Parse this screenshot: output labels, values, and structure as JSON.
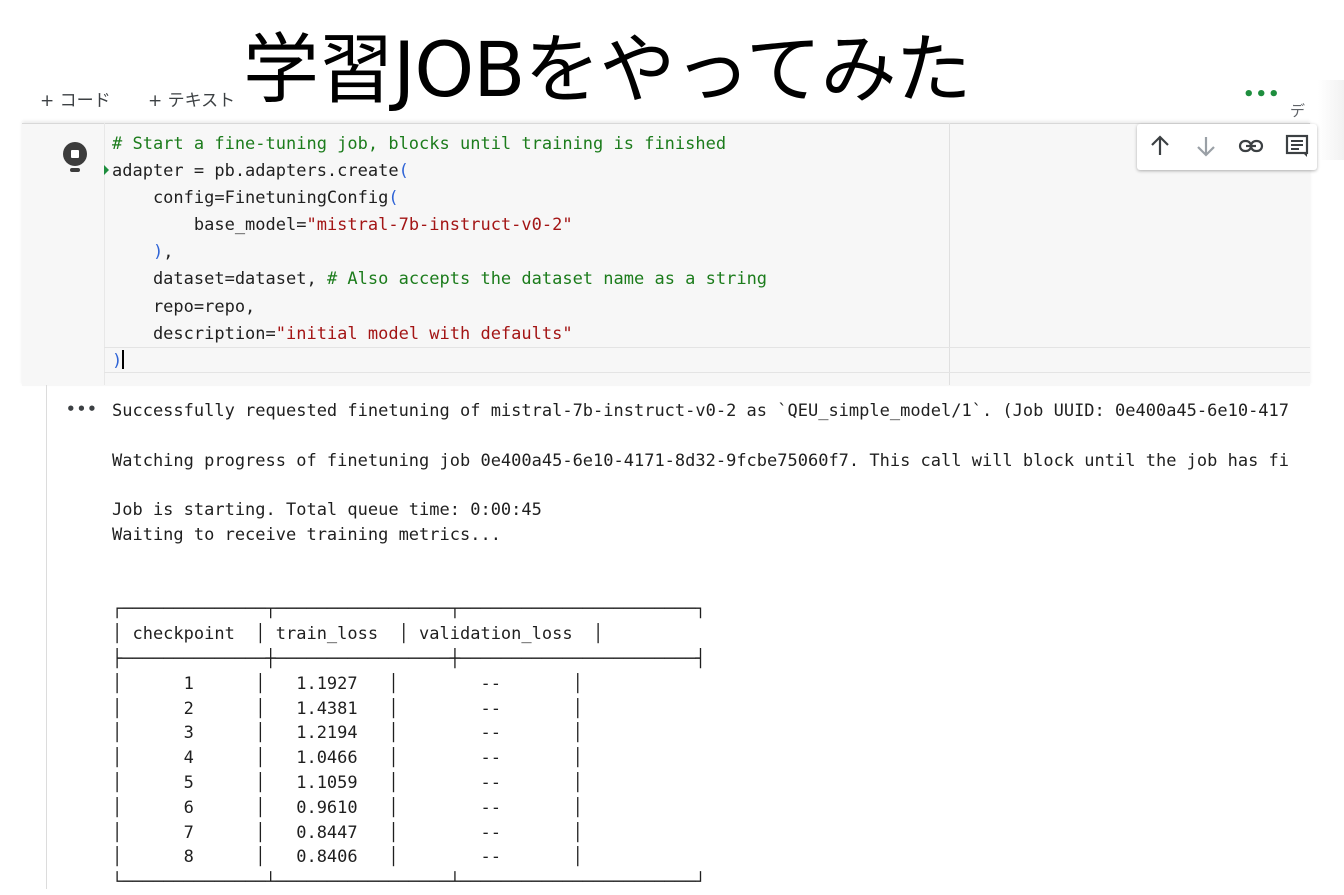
{
  "slide_title": "学習JOBをやってみた",
  "toolbar": {
    "add_code": "+ コード",
    "add_text": "+ テキスト",
    "more": "•••",
    "clipped_label": "デ"
  },
  "cell": {
    "code_lines": [
      "# Start a fine-tuning job, blocks until training is finished",
      "adapter = pb.adapters.create(",
      "    config=FinetuningConfig(",
      "        base_model=\"mistral-7b-instruct-v0-2\"",
      "    ),",
      "    dataset=dataset, # Also accepts the dataset name as a string",
      "    repo=repo,",
      "    description=\"initial model with defaults\"",
      ")"
    ],
    "toolbar_icons": [
      "arrow-up-icon",
      "arrow-down-icon",
      "link-icon",
      "comment-icon"
    ]
  },
  "output": {
    "more": "•••",
    "lines": [
      "Successfully requested finetuning of mistral-7b-instruct-v0-2 as `QEU_simple_model/1`. (Job UUID: 0e400a45-6e10-417",
      "",
      "Watching progress of finetuning job 0e400a45-6e10-4171-8d32-9fcbe75060f7. This call will block until the job has fi",
      "",
      "Job is starting. Total queue time: 0:00:45",
      "Waiting to receive training metrics...",
      "",
      "",
      "┌──────────────┬─────────────────┬───────────────────────┐",
      "│ checkpoint  │ train_loss  │ validation_loss  │",
      "├──────────────┼─────────────────┼───────────────────────┤",
      "│      1      │   1.1927   │        --       │",
      "│      2      │   1.4381   │        --       │",
      "│      3      │   1.2194   │        --       │",
      "│      4      │   1.0466   │        --       │",
      "│      5      │   1.1059   │        --       │",
      "│      6      │   0.9610   │        --       │",
      "│      7      │   0.8447   │        --       │",
      "│      8      │   0.8406   │        --       │",
      "└──────────────┴─────────────────┴───────────────────────┘"
    ]
  },
  "colors": {
    "comment": "#1c7c1c",
    "string": "#a31515",
    "accent": "#1e8e3e"
  }
}
